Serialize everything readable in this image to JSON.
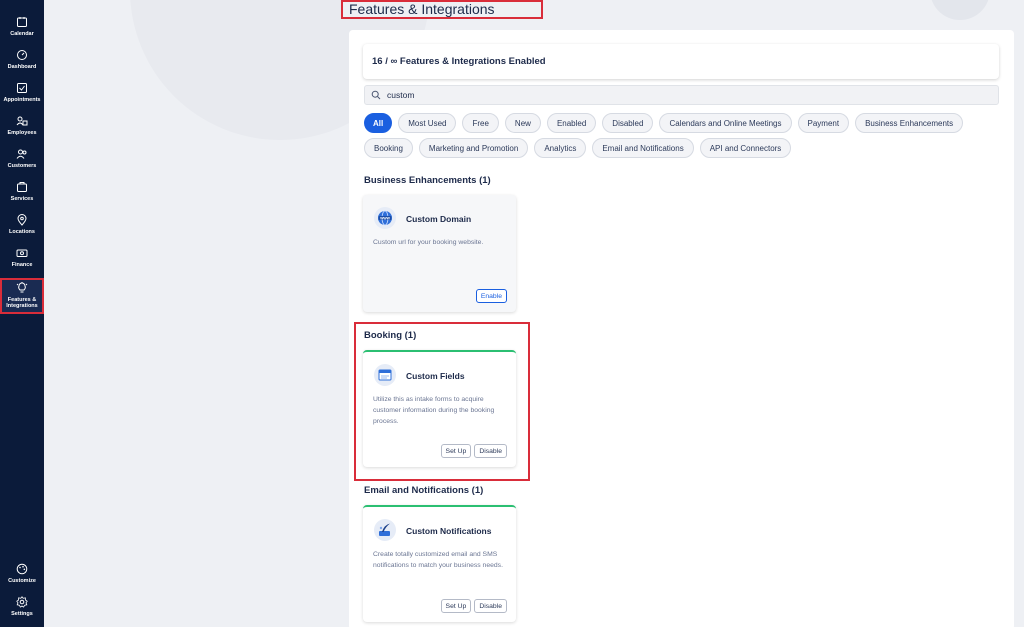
{
  "sidebar": {
    "items": [
      {
        "label": "Calendar",
        "icon": "calendar-icon"
      },
      {
        "label": "Dashboard",
        "icon": "dashboard-icon"
      },
      {
        "label": "Appointments",
        "icon": "appointments-icon"
      },
      {
        "label": "Employees",
        "icon": "employees-icon"
      },
      {
        "label": "Customers",
        "icon": "customers-icon"
      },
      {
        "label": "Services",
        "icon": "services-icon"
      },
      {
        "label": "Locations",
        "icon": "location-pin-icon"
      },
      {
        "label": "Finance",
        "icon": "finance-icon"
      },
      {
        "label": "Features & Integrations",
        "icon": "lightbulb-icon",
        "active": true
      }
    ],
    "bottom_items": [
      {
        "label": "Customize",
        "icon": "palette-icon"
      },
      {
        "label": "Settings",
        "icon": "gear-icon"
      }
    ]
  },
  "page": {
    "title": "Features & Integrations",
    "count_text": "16 / ∞ Features & Integrations Enabled",
    "search_value": "custom"
  },
  "filters": {
    "row1": [
      "All",
      "Most Used",
      "Free",
      "New",
      "Enabled",
      "Disabled",
      "Calendars and Online Meetings",
      "Payment",
      "Business Enhancements"
    ],
    "row2": [
      "Booking",
      "Marketing and Promotion",
      "Analytics",
      "Email and Notifications",
      "API and Connectors"
    ],
    "active": "All"
  },
  "sections": [
    {
      "title": "Business Enhancements (1)",
      "card": {
        "name": "Custom Domain",
        "icon": "globe-www-icon",
        "description": "Custom url for your booking website.",
        "enabled": false,
        "buttons": [
          "Enable"
        ]
      }
    },
    {
      "title": "Booking (1)",
      "card": {
        "name": "Custom Fields",
        "icon": "form-fields-icon",
        "description": "Utilize this as intake forms to acquire customer information during the booking process.",
        "enabled": true,
        "buttons": [
          "Set Up",
          "Disable"
        ]
      }
    },
    {
      "title": "Email and Notifications (1)",
      "card": {
        "name": "Custom Notifications",
        "icon": "notification-quill-icon",
        "description": "Create totally customized email and SMS notifications to match your business needs.",
        "enabled": true,
        "buttons": [
          "Set Up",
          "Disable"
        ]
      }
    }
  ],
  "colors": {
    "sidebar_bg": "#0b1b3a",
    "accent": "#1a5fe0",
    "enabled_border": "#2bbf72",
    "highlight": "#d92d3a"
  }
}
